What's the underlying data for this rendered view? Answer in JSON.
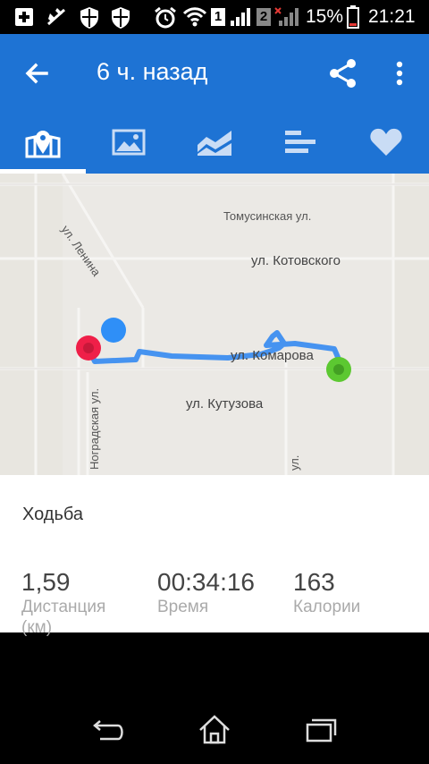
{
  "status_bar": {
    "sim1_label": "1",
    "sim2_label": "2",
    "battery": "15%",
    "time": "21:21",
    "icons": [
      "plus-box-icon",
      "no-signal-icon",
      "shield-icon",
      "shield-icon",
      "alarm-icon",
      "wifi-icon",
      "signal-icon",
      "battery-icon"
    ]
  },
  "app_bar": {
    "title": "6 ч. назад",
    "color": "#1e73d4"
  },
  "tabs": [
    {
      "name": "map",
      "icon": "map-pin-icon",
      "active": true
    },
    {
      "name": "photos",
      "icon": "image-icon",
      "active": false
    },
    {
      "name": "charts",
      "icon": "area-chart-icon",
      "active": false
    },
    {
      "name": "splits",
      "icon": "bars-icon",
      "active": false
    },
    {
      "name": "favorite",
      "icon": "heart-icon",
      "active": false
    }
  ],
  "map": {
    "streets": [
      "Томусинская ул.",
      "ул. Котовского",
      "ул. Ленина",
      "ул. Комарова",
      "ул. Кутузова",
      "Ноградская ул.",
      "ул."
    ],
    "route_color": "#3d8ef0",
    "start_color": "#5cc831",
    "end_color": "#ef1f48",
    "location_color": "#2f8ff7"
  },
  "activity": {
    "type": "Ходьба",
    "stats": [
      {
        "value": "1,59",
        "label": "Дистанция"
      },
      {
        "value": "00:34:16",
        "label": "Время"
      },
      {
        "value": "163",
        "label": "Калории"
      }
    ],
    "distance_unit_partial": "(км)"
  },
  "nav_bar": {
    "buttons": [
      "back-icon",
      "home-icon",
      "recents-icon"
    ]
  }
}
